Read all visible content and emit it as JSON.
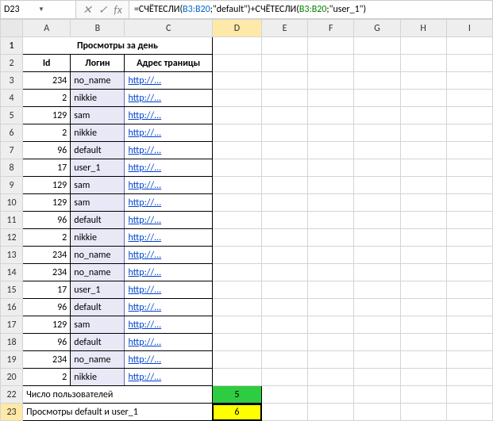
{
  "nameBox": "D23",
  "formula": {
    "prefix": "=СЧЁТЕСЛИ(",
    "range1": "B3:B20",
    "mid1": ";\"default\")+СЧЁТЕСЛИ(",
    "range2": "B3:B20",
    "suffix": ";\"user_1\")"
  },
  "cols": [
    "A",
    "B",
    "C",
    "D",
    "E",
    "F",
    "G",
    "H",
    "I"
  ],
  "rowsHead": [
    "1",
    "2",
    "3",
    "4",
    "5",
    "6",
    "7",
    "8",
    "9",
    "10",
    "11",
    "12",
    "13",
    "14",
    "15",
    "16",
    "17",
    "18",
    "19",
    "20",
    "22",
    "23"
  ],
  "title": "Просмотры за день",
  "headers": {
    "id": "Id",
    "login": "Логин",
    "page": "Адрес траницы"
  },
  "data": [
    {
      "id": "234",
      "login": "no_name",
      "link": "http://..."
    },
    {
      "id": "2",
      "login": "nikkie",
      "link": "http://..."
    },
    {
      "id": "129",
      "login": "sam",
      "link": "http://..."
    },
    {
      "id": "2",
      "login": "nikkie",
      "link": "http://..."
    },
    {
      "id": "96",
      "login": "default",
      "link": "http://..."
    },
    {
      "id": "17",
      "login": "user_1",
      "link": "http://..."
    },
    {
      "id": "129",
      "login": "sam",
      "link": "http://..."
    },
    {
      "id": "129",
      "login": "sam",
      "link": "http://..."
    },
    {
      "id": "96",
      "login": "default",
      "link": "http://..."
    },
    {
      "id": "2",
      "login": "nikkie",
      "link": "http://..."
    },
    {
      "id": "234",
      "login": "no_name",
      "link": "http://..."
    },
    {
      "id": "234",
      "login": "no_name",
      "link": "http://..."
    },
    {
      "id": "17",
      "login": "user_1",
      "link": "http://..."
    },
    {
      "id": "96",
      "login": "default",
      "link": "http://..."
    },
    {
      "id": "129",
      "login": "sam",
      "link": "http://..."
    },
    {
      "id": "96",
      "login": "default",
      "link": "http://..."
    },
    {
      "id": "234",
      "login": "no_name",
      "link": "http://..."
    },
    {
      "id": "2",
      "login": "nikkie",
      "link": "http://..."
    }
  ],
  "summary": {
    "row22_label": "Число пользователей",
    "row22_value": "5",
    "row23_label": "Просмотры default и user_1",
    "row23_value": "6"
  }
}
